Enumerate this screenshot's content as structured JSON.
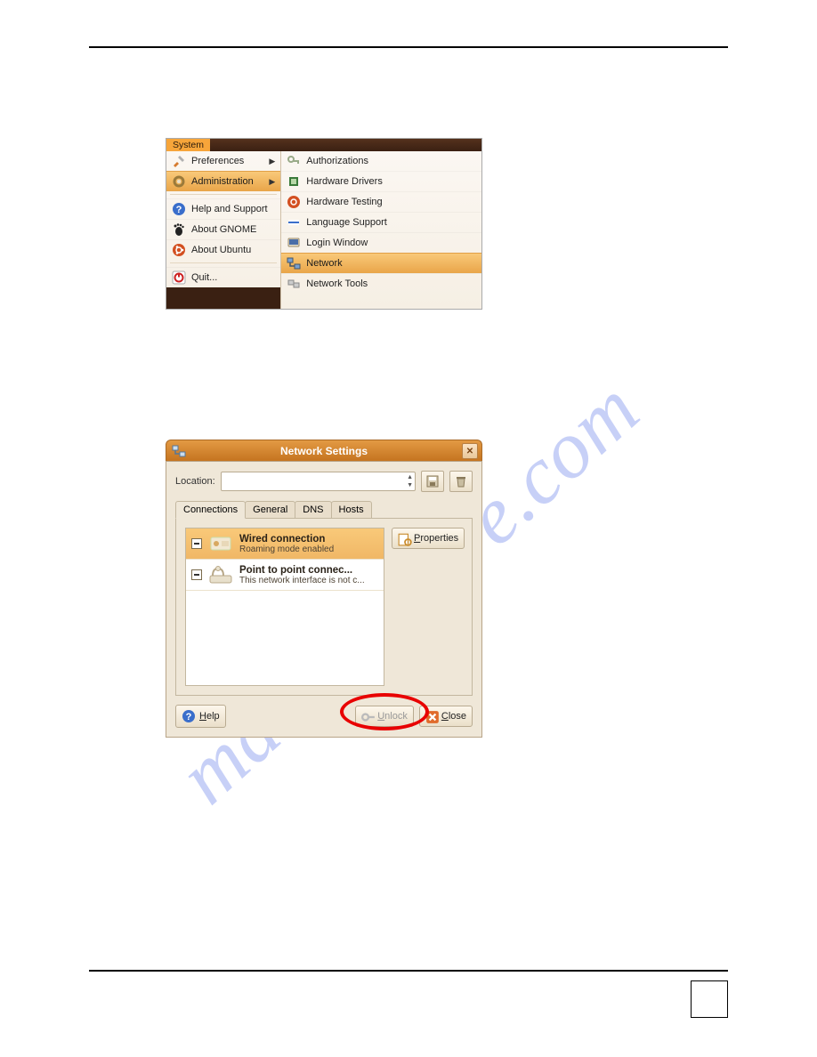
{
  "watermark": "manualshive.com",
  "menu": {
    "tab": "System",
    "left": [
      {
        "label": "Preferences",
        "arrow": true,
        "iconColor": "#d67b2f",
        "icon": "prefs"
      },
      {
        "label": "Administration",
        "arrow": true,
        "hl": true,
        "iconColor": "#c98c2d",
        "icon": "gear"
      },
      {
        "label": "Help and Support",
        "sepBefore": true,
        "iconColor": "#3a6ecb",
        "icon": "help"
      },
      {
        "label": "About GNOME",
        "iconColor": "#222",
        "icon": "foot"
      },
      {
        "label": "About Ubuntu",
        "iconColor": "#d35021",
        "icon": "swirl"
      },
      {
        "label": "Quit...",
        "sepBefore": true,
        "iconColor": "#c22",
        "icon": "power"
      }
    ],
    "right": [
      {
        "label": "Authorizations",
        "icon": "keys"
      },
      {
        "label": "Hardware Drivers",
        "icon": "chip"
      },
      {
        "label": "Hardware Testing",
        "icon": "swirl"
      },
      {
        "label": "Language Support",
        "icon": "flag"
      },
      {
        "label": "Login Window",
        "icon": "screen"
      },
      {
        "label": "Network",
        "hl": true,
        "icon": "net"
      },
      {
        "label": "Network Tools",
        "icon": "nettools"
      }
    ]
  },
  "dialog": {
    "title": "Network Settings",
    "locationLabel": "Location:",
    "tabs": [
      "Connections",
      "General",
      "DNS",
      "Hosts"
    ],
    "connections": [
      {
        "title": "Wired connection",
        "sub": "Roaming mode enabled",
        "sel": true
      },
      {
        "title": "Point to point connec...",
        "sub": "This network interface is not c..."
      }
    ],
    "propertiesLabel": "Properties",
    "helpLabel": "Help",
    "unlockLabel": "Unlock",
    "closeLabel": "Close"
  }
}
